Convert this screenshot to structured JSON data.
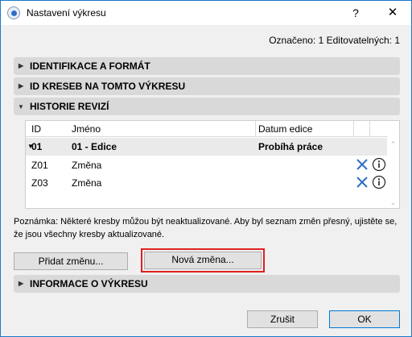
{
  "window": {
    "title": "Nastavení výkresu",
    "help_label": "?",
    "close_label": "✕"
  },
  "selection_info": "Označeno: 1 Editovatelných: 1",
  "sections": {
    "identification": "IDENTIFIKACE A FORMÁT",
    "drawing_ids": "ID KRESEB NA TOMTO VÝKRESU",
    "revision_history": "HISTORIE REVIZÍ",
    "drawing_info": "INFORMACE O VÝKRESU"
  },
  "table": {
    "columns": [
      "ID",
      "Jméno",
      "Datum edice"
    ],
    "rows": [
      {
        "id": "01",
        "name": "01 - Edice",
        "date": "Probíhá práce",
        "type": "group"
      },
      {
        "id": "Z01",
        "name": "Změna",
        "date": "",
        "type": "change"
      },
      {
        "id": "Z03",
        "name": "Změna",
        "date": "",
        "type": "change"
      }
    ]
  },
  "note": "Poznámka: Některé kresby můžou být neaktualizované. Aby byl seznam změn přesný, ujistěte se, že jsou všechny kresby aktualizované.",
  "buttons": {
    "add_change": "Přidat změnu...",
    "new_change": "Nová změna...",
    "cancel": "Zrušit",
    "ok": "OK"
  },
  "icons": {
    "remove_color": "#2f6fc1",
    "highlight_color": "#e02020"
  }
}
